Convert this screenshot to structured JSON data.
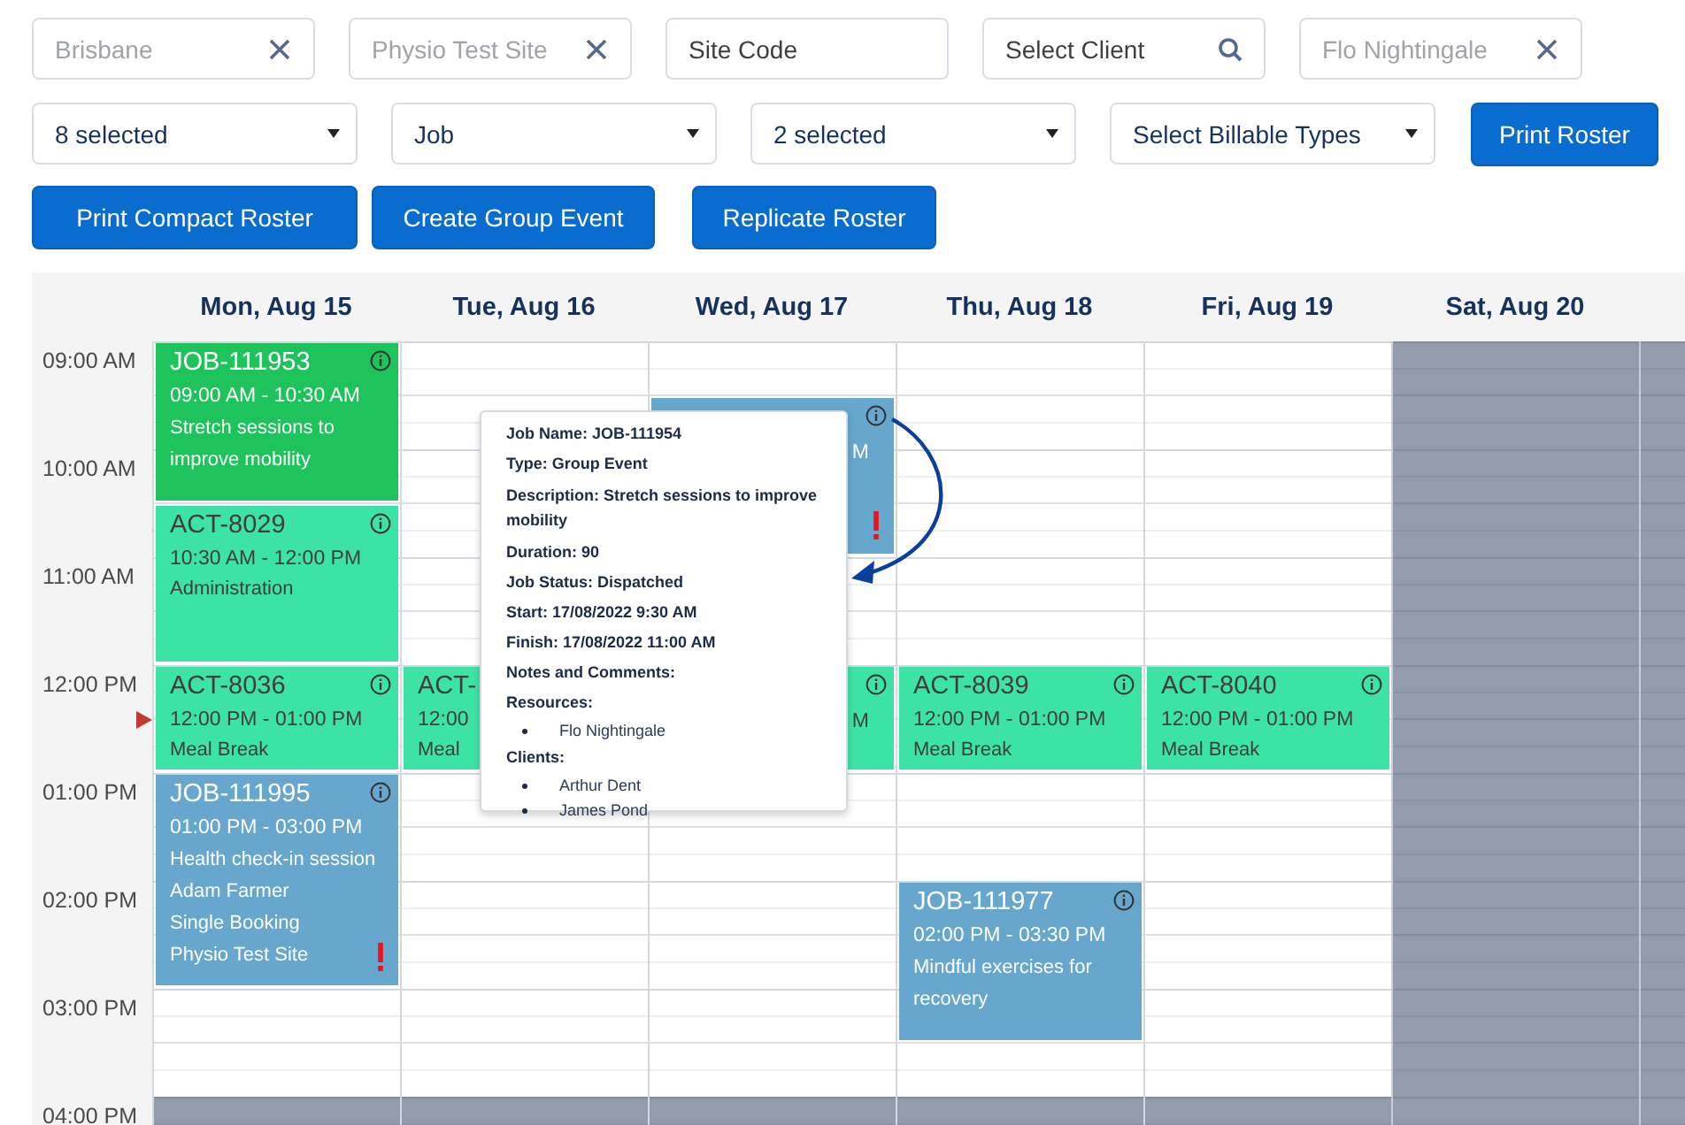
{
  "filters": [
    {
      "kind": "clearable",
      "text": "Brisbane",
      "disabled": true
    },
    {
      "kind": "clearable",
      "text": "Physio Test Site",
      "disabled": true
    },
    {
      "kind": "plain",
      "text": "Site Code",
      "disabled": false
    },
    {
      "kind": "search",
      "text": "Select Client",
      "disabled": false
    },
    {
      "kind": "clearable",
      "text": "Flo Nightingale",
      "disabled": true
    }
  ],
  "selects": [
    "8 selected",
    "Job",
    "2 selected",
    "Select Billable Types"
  ],
  "print_button": "Print Roster",
  "action_buttons": [
    "Print Compact Roster",
    "Create Group Event",
    "Replicate Roster"
  ],
  "calendar": {
    "time_rows": [
      {
        "label": "09:00 AM",
        "closed": false
      },
      {
        "label": "10:00 AM",
        "closed": false
      },
      {
        "label": "11:00 AM",
        "closed": false
      },
      {
        "label": "12:00 PM",
        "closed": false
      },
      {
        "label": "01:00 PM",
        "closed": false
      },
      {
        "label": "02:00 PM",
        "closed": false
      },
      {
        "label": "03:00 PM",
        "closed": false
      },
      {
        "label": "04:00 PM",
        "closed": true
      }
    ],
    "days": [
      {
        "label": "Mon, Aug 15",
        "shaded": false,
        "events": [
          {
            "kind": "job",
            "color": "#1ec35c",
            "title": "JOB-111953",
            "time": "09:00 AM - 10:30 AM",
            "lines": [
              "Stretch sessions to",
              "improve mobility"
            ],
            "alert": false,
            "covered": false
          },
          {
            "kind": "activity",
            "color": "#3de3a5",
            "title": "ACT-8029",
            "time": "10:30 AM - 12:00 PM",
            "lines": [
              "Administration"
            ],
            "alert": false,
            "covered": false
          },
          {
            "kind": "activity",
            "color": "#3de3a5",
            "title": "ACT-8036",
            "time": "12:00 PM - 01:00 PM",
            "lines": [
              "Meal Break"
            ],
            "alert": false,
            "covered": false
          },
          {
            "kind": "job",
            "color": "#67a7cd",
            "title": "JOB-111995",
            "time": "01:00 PM - 03:00 PM",
            "lines": [
              "Health check-in session",
              "Adam Farmer",
              "Single Booking",
              "Physio Test Site"
            ],
            "alert": true,
            "covered": false
          }
        ]
      },
      {
        "label": "Tue, Aug 16",
        "shaded": false,
        "events": [
          {
            "kind": "activity",
            "color": "#3de3a5",
            "title": "ACT-",
            "time": "12:00",
            "lines": [
              "Meal"
            ],
            "covered": false
          }
        ]
      },
      {
        "label": "Wed, Aug 17",
        "shaded": false,
        "events": [
          {
            "kind": "job",
            "color": "#67a7cd",
            "time": "M",
            "alert": true,
            "covered": true
          },
          {
            "kind": "activity",
            "color": "#3de3a5",
            "time": "M",
            "alert": false,
            "covered": true
          }
        ]
      },
      {
        "label": "Thu, Aug 18",
        "shaded": false,
        "events": [
          {
            "kind": "activity",
            "color": "#3de3a5",
            "title": "ACT-8039",
            "time": "12:00 PM - 01:00 PM",
            "lines": [
              "Meal Break"
            ],
            "alert": false,
            "covered": false
          },
          {
            "kind": "job",
            "color": "#67a7cd",
            "title": "JOB-111977",
            "time": "02:00 PM - 03:30 PM",
            "lines": [
              "Mindful exercises for",
              "recovery"
            ],
            "alert": false,
            "covered": false
          }
        ]
      },
      {
        "label": "Fri, Aug 19",
        "shaded": false,
        "events": [
          {
            "kind": "activity",
            "color": "#3de3a5",
            "title": "ACT-8040",
            "time": "12:00 PM - 01:00 PM",
            "lines": [
              "Meal Break"
            ],
            "alert": false,
            "covered": false
          }
        ]
      },
      {
        "label": "Sat, Aug 20",
        "shaded": true
      },
      {
        "shaded": true
      }
    ]
  },
  "popover": {
    "lines": [
      "Job Name: JOB-111954",
      "Type: Group Event",
      "Description: Stretch sessions to improve mobility",
      "Duration: 90",
      "Job Status: Dispatched",
      "Start: 17/08/2022 9:30 AM",
      "Finish: 17/08/2022 11:00 AM",
      "Notes and Comments:"
    ],
    "sections": [
      {
        "heading": "Resources:",
        "items": [
          "Flo Nightingale"
        ]
      },
      {
        "heading": "Clients:",
        "items": [
          "Arthur Dent",
          "James Pond"
        ]
      }
    ]
  }
}
